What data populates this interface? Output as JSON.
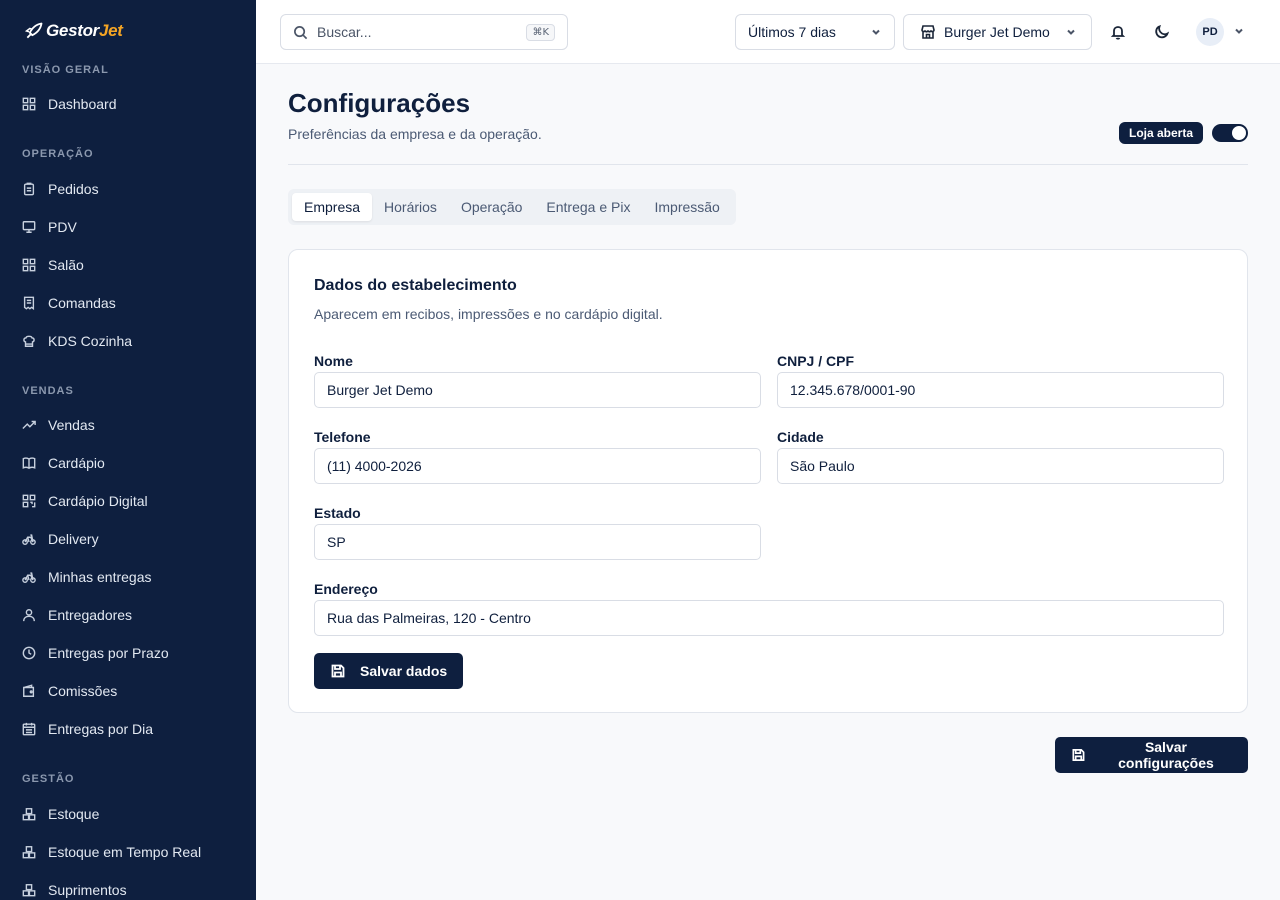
{
  "brand": {
    "name_prefix": "Gestor",
    "name_suffix": "Jet"
  },
  "sidebar": {
    "sections": [
      {
        "label": "VISÃO GERAL"
      },
      {
        "label": "OPERAÇÃO"
      },
      {
        "label": "VENDAS"
      },
      {
        "label": "GESTÃO"
      }
    ],
    "items": [
      {
        "label": "Dashboard",
        "icon": "grid-icon"
      },
      {
        "label": "Pedidos",
        "icon": "clipboard-icon"
      },
      {
        "label": "PDV",
        "icon": "monitor-icon"
      },
      {
        "label": "Salão",
        "icon": "grid-icon"
      },
      {
        "label": "Comandas",
        "icon": "receipt-icon"
      },
      {
        "label": "KDS Cozinha",
        "icon": "chef-icon"
      },
      {
        "label": "Vendas",
        "icon": "trend-up-icon"
      },
      {
        "label": "Cardápio",
        "icon": "book-icon"
      },
      {
        "label": "Cardápio Digital",
        "icon": "qr-icon"
      },
      {
        "label": "Delivery",
        "icon": "bike-icon"
      },
      {
        "label": "Minhas entregas",
        "icon": "bike-icon"
      },
      {
        "label": "Entregadores",
        "icon": "user-icon"
      },
      {
        "label": "Entregas por Prazo",
        "icon": "clock-icon"
      },
      {
        "label": "Comissões",
        "icon": "wallet-icon"
      },
      {
        "label": "Entregas por Dia",
        "icon": "calendar-icon"
      },
      {
        "label": "Estoque",
        "icon": "boxes-icon"
      },
      {
        "label": "Estoque em Tempo Real",
        "icon": "boxes-icon"
      },
      {
        "label": "Suprimentos",
        "icon": "boxes-icon"
      }
    ]
  },
  "topbar": {
    "search_placeholder": "Buscar...",
    "search_shortcut": "⌘K",
    "period": "Últimos 7 dias",
    "store": "Burger Jet Demo",
    "avatar_initials": "PD"
  },
  "page": {
    "title": "Configurações",
    "subtitle": "Preferências da empresa e da operação.",
    "store_status": "Loja aberta",
    "store_open": true
  },
  "tabs": [
    {
      "label": "Empresa",
      "active": true
    },
    {
      "label": "Horários",
      "active": false
    },
    {
      "label": "Operação",
      "active": false
    },
    {
      "label": "Entrega e Pix",
      "active": false
    },
    {
      "label": "Impressão",
      "active": false
    }
  ],
  "card": {
    "title": "Dados do estabelecimento",
    "subtitle": "Aparecem em recibos, impressões e no cardápio digital.",
    "fields": [
      {
        "label": "Nome",
        "value": "Burger Jet Demo"
      },
      {
        "label": "CNPJ / CPF",
        "value": "12.345.678/0001-90"
      },
      {
        "label": "Telefone",
        "value": "(11) 4000-2026"
      },
      {
        "label": "Cidade",
        "value": "São Paulo"
      },
      {
        "label": "Estado",
        "value": "SP"
      },
      {
        "label": "Endereço",
        "value": "Rua das Palmeiras, 120 - Centro"
      }
    ],
    "save_label": "Salvar dados"
  },
  "footer": {
    "save_all_label": "Salvar configurações"
  },
  "colors": {
    "navy": "#0e1f3f",
    "accent": "#f5a524",
    "background": "#f8f9fb"
  }
}
